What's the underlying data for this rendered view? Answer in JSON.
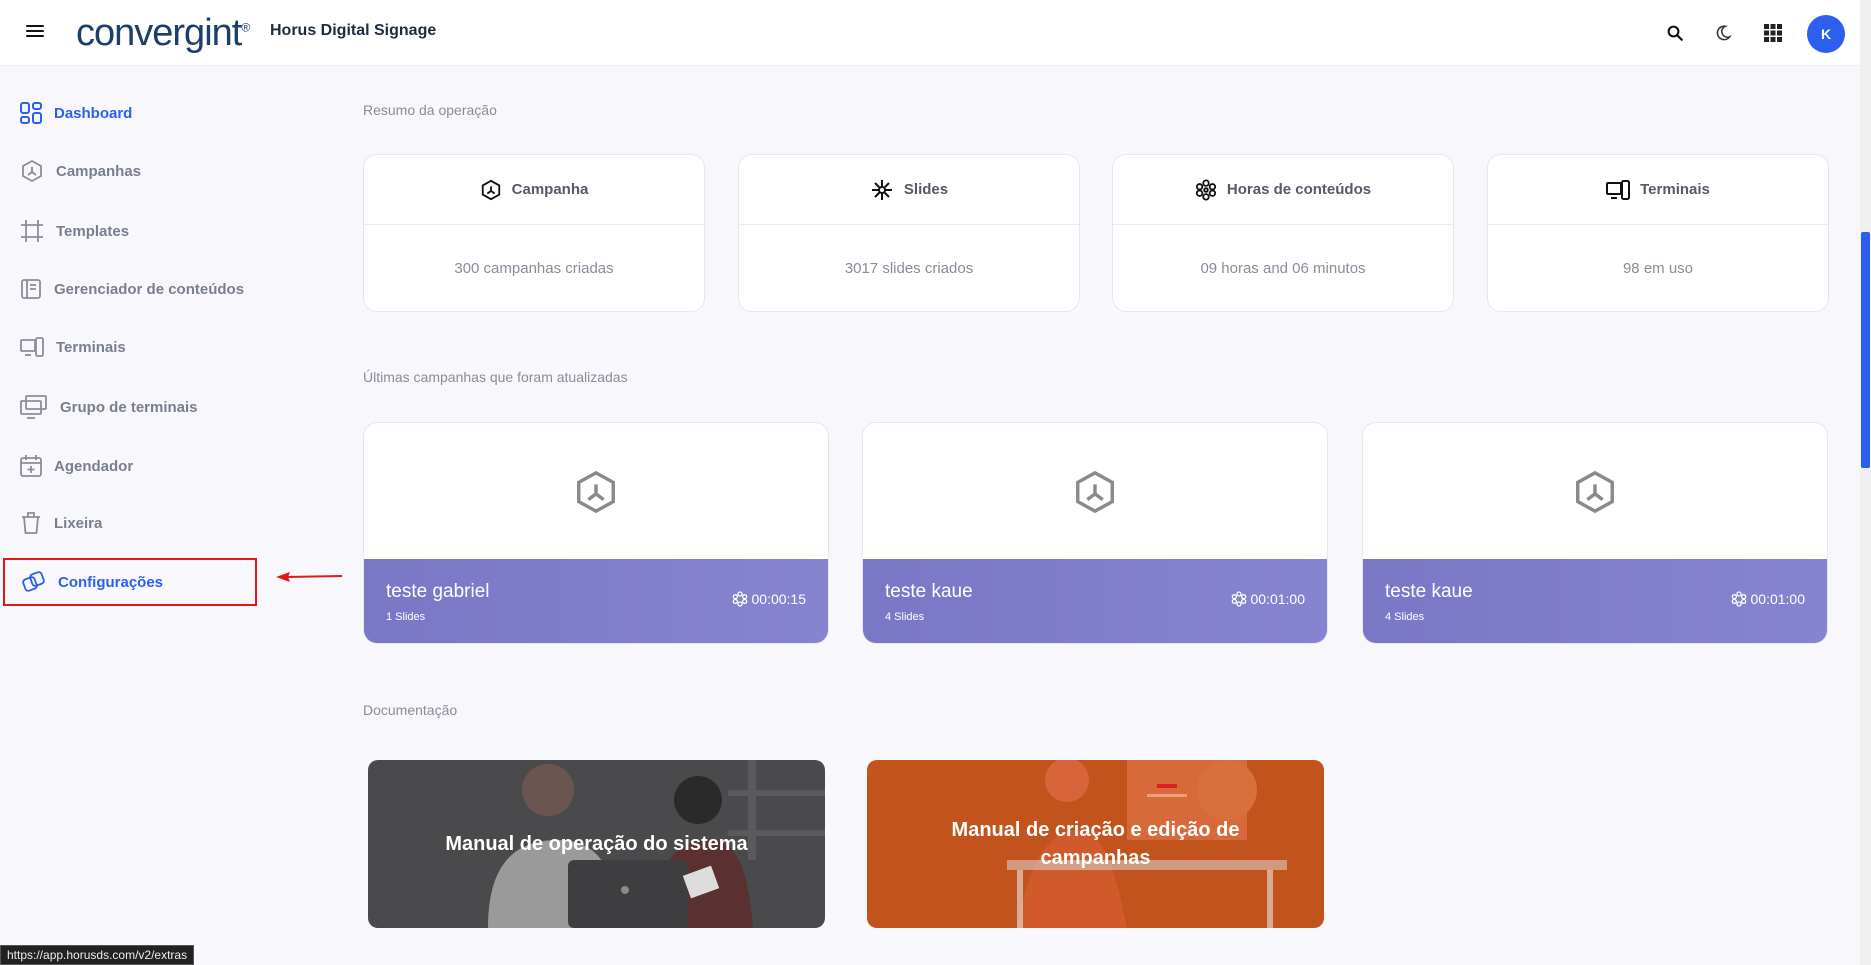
{
  "header": {
    "logo_text": "convergint",
    "logo_sup": "®",
    "app_title": "Horus Digital Signage",
    "avatar_initial": "K"
  },
  "sidebar": {
    "items": [
      {
        "label": "Dashboard",
        "icon": "dashboard-icon",
        "active": true
      },
      {
        "label": "Campanhas",
        "icon": "campaign-icon"
      },
      {
        "label": "Templates",
        "icon": "template-icon"
      },
      {
        "label": "Gerenciador de conteúdos",
        "icon": "content-manager-icon"
      },
      {
        "label": "Terminais",
        "icon": "terminal-icon"
      },
      {
        "label": "Grupo de terminais",
        "icon": "terminal-group-icon"
      },
      {
        "label": "Agendador",
        "icon": "calendar-icon"
      },
      {
        "label": "Lixeira",
        "icon": "trash-icon"
      },
      {
        "label": "Configurações",
        "icon": "settings-icon"
      }
    ]
  },
  "summary": {
    "title": "Resumo da operação",
    "cards": [
      {
        "label": "Campanha",
        "value": "300 campanhas criadas",
        "icon": "campaign-icon"
      },
      {
        "label": "Slides",
        "value": "3017 slides criados",
        "icon": "slides-icon"
      },
      {
        "label": "Horas de conteúdos",
        "value": "09 horas and 06 minutos",
        "icon": "content-hours-icon"
      },
      {
        "label": "Terminais",
        "value": "98 em uso",
        "icon": "terminal-icon"
      }
    ]
  },
  "recent": {
    "title": "Últimas campanhas que foram atualizadas",
    "campaigns": [
      {
        "name": "teste gabriel",
        "slides": "1 Slides",
        "duration": "00:00:15"
      },
      {
        "name": "teste kaue",
        "slides": "4 Slides",
        "duration": "00:01:00"
      },
      {
        "name": "teste kaue",
        "slides": "4 Slides",
        "duration": "00:01:00"
      }
    ]
  },
  "docs": {
    "title": "Documentação",
    "items": [
      {
        "title": "Manual de operação do sistema"
      },
      {
        "title": "Manual de criação e edição de campanhas"
      }
    ]
  },
  "status_bar": {
    "url": "https://app.horusds.com/v2/extras"
  },
  "colors": {
    "accent": "#2b5ff0",
    "campaign_banner": "#7a77c6",
    "highlight": "#e01818"
  }
}
